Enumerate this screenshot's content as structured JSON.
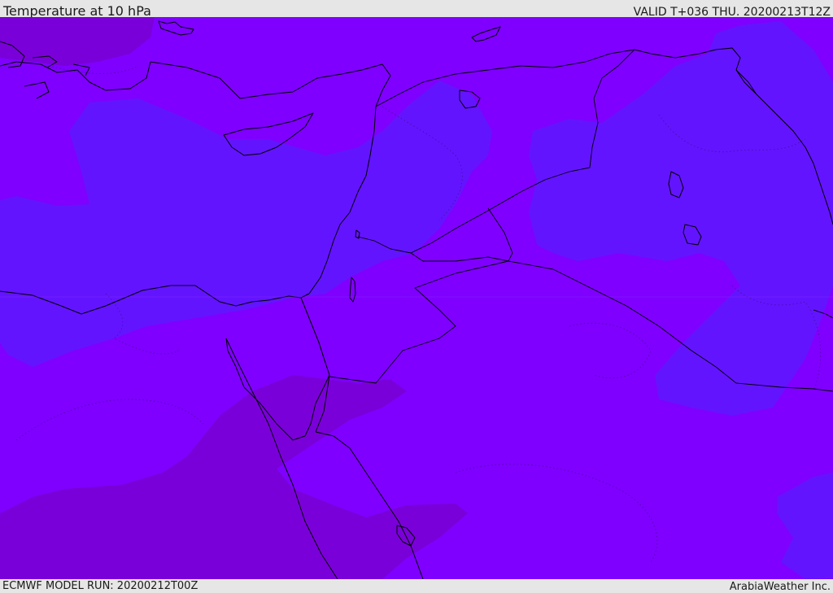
{
  "header": {
    "title": "Temperature at 10 hPa",
    "valid": "VALID T+036 THU. 20200213T12Z"
  },
  "footer": {
    "model_run": "ECMWF MODEL RUN: 20200212T00Z",
    "credit": "ArabiaWeather Inc."
  },
  "map": {
    "variable": "Temperature",
    "level": "10 hPa",
    "colors": {
      "main_field": "#7f00ff",
      "cooler_field": "#6314ff",
      "warmer_field": "#7a00d9",
      "coastline": "#000000"
    }
  }
}
